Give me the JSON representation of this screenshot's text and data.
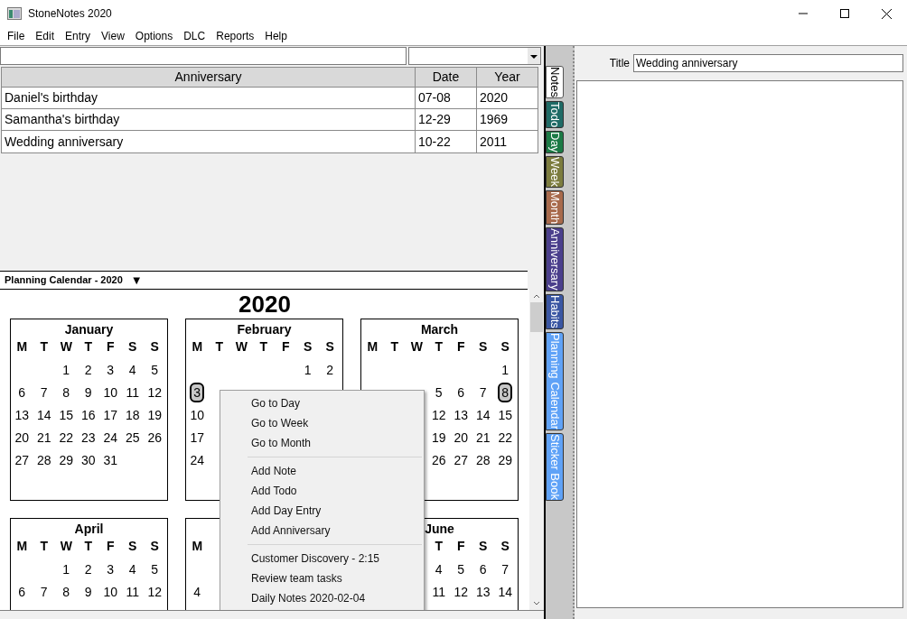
{
  "window": {
    "title": "StoneNotes 2020"
  },
  "menu_bar": [
    "File",
    "Edit",
    "Entry",
    "View",
    "Options",
    "DLC",
    "Reports",
    "Help"
  ],
  "table": {
    "columns": [
      "Anniversary",
      "Date",
      "Year"
    ],
    "rows": [
      [
        "Daniel's birthday",
        "07-08",
        "2020"
      ],
      [
        "Samantha's birthday",
        "12-29",
        "1969"
      ],
      [
        "Wedding anniversary",
        "10-22",
        "2011"
      ]
    ]
  },
  "calendar": {
    "header": "Planning Calendar - 2020",
    "dropdown_glyph": "▼",
    "year": "2020",
    "months": [
      {
        "name": "January",
        "weekdays": [
          {
            "kind": "letter",
            "text": "M"
          },
          {
            "kind": "letter",
            "text": "T"
          },
          {
            "kind": "letter",
            "text": "W"
          },
          {
            "kind": "letter",
            "text": "T"
          },
          {
            "kind": "letter",
            "text": "F"
          },
          {
            "kind": "letter",
            "text": "S"
          },
          {
            "kind": "letter",
            "text": "S"
          }
        ],
        "weeks": [
          [
            {
              "kind": "blank"
            },
            {
              "kind": "blank"
            },
            {
              "kind": "day",
              "day": "1",
              "marked": false
            },
            {
              "kind": "day",
              "day": "2",
              "marked": false
            },
            {
              "kind": "day",
              "day": "3",
              "marked": false
            },
            {
              "kind": "day",
              "day": "4",
              "marked": false
            },
            {
              "kind": "day",
              "day": "5",
              "marked": false
            }
          ],
          [
            {
              "kind": "day",
              "day": "6",
              "marked": false
            },
            {
              "kind": "day",
              "day": "7",
              "marked": false
            },
            {
              "kind": "day",
              "day": "8",
              "marked": false
            },
            {
              "kind": "day",
              "day": "9",
              "marked": false
            },
            {
              "kind": "day",
              "day": "10",
              "marked": false
            },
            {
              "kind": "day",
              "day": "11",
              "marked": false
            },
            {
              "kind": "day",
              "day": "12",
              "marked": false
            }
          ],
          [
            {
              "kind": "day",
              "day": "13",
              "marked": false
            },
            {
              "kind": "day",
              "day": "14",
              "marked": false
            },
            {
              "kind": "day",
              "day": "15",
              "marked": false
            },
            {
              "kind": "day",
              "day": "16",
              "marked": false
            },
            {
              "kind": "day",
              "day": "17",
              "marked": false
            },
            {
              "kind": "day",
              "day": "18",
              "marked": false
            },
            {
              "kind": "day",
              "day": "19",
              "marked": false
            }
          ],
          [
            {
              "kind": "day",
              "day": "20",
              "marked": false
            },
            {
              "kind": "day",
              "day": "21",
              "marked": false
            },
            {
              "kind": "day",
              "day": "22",
              "marked": false
            },
            {
              "kind": "day",
              "day": "23",
              "marked": false
            },
            {
              "kind": "day",
              "day": "24",
              "marked": false
            },
            {
              "kind": "day",
              "day": "25",
              "marked": false
            },
            {
              "kind": "day",
              "day": "26",
              "marked": false
            }
          ],
          [
            {
              "kind": "day",
              "day": "27",
              "marked": false
            },
            {
              "kind": "day",
              "day": "28",
              "marked": false
            },
            {
              "kind": "day",
              "day": "29",
              "marked": false
            },
            {
              "kind": "day",
              "day": "30",
              "marked": false
            },
            {
              "kind": "day",
              "day": "31",
              "marked": false
            },
            {
              "kind": "blank"
            },
            {
              "kind": "blank"
            }
          ]
        ]
      },
      {
        "name": "February",
        "weekdays": [
          {
            "kind": "letter",
            "text": "M"
          },
          {
            "kind": "letter",
            "text": "T"
          },
          {
            "kind": "letter",
            "text": "W"
          },
          {
            "kind": "letter",
            "text": "T"
          },
          {
            "kind": "letter",
            "text": "F"
          },
          {
            "kind": "letter",
            "text": "S"
          },
          {
            "kind": "letter",
            "text": "S"
          }
        ],
        "weeks": [
          [
            {
              "kind": "blank"
            },
            {
              "kind": "blank"
            },
            {
              "kind": "blank"
            },
            {
              "kind": "blank"
            },
            {
              "kind": "blank"
            },
            {
              "kind": "day",
              "day": "1",
              "marked": false
            },
            {
              "kind": "day",
              "day": "2",
              "marked": false
            }
          ],
          [
            {
              "kind": "day",
              "day": "3",
              "marked": true
            }
          ],
          [
            {
              "kind": "day",
              "day": "10",
              "marked": false
            }
          ],
          [
            {
              "kind": "day",
              "day": "17",
              "marked": false
            }
          ],
          [
            {
              "kind": "day",
              "day": "24",
              "marked": false
            }
          ]
        ]
      },
      {
        "name": "March",
        "weekdays": [
          {
            "kind": "letter",
            "text": "M"
          },
          {
            "kind": "letter",
            "text": "T"
          },
          {
            "kind": "letter",
            "text": "W"
          },
          {
            "kind": "letter",
            "text": "T"
          },
          {
            "kind": "letter",
            "text": "F"
          },
          {
            "kind": "letter",
            "text": "S"
          },
          {
            "kind": "letter",
            "text": "S"
          }
        ],
        "weeks": [
          [
            {
              "kind": "blank"
            },
            {
              "kind": "blank"
            },
            {
              "kind": "blank"
            },
            {
              "kind": "blank"
            },
            {
              "kind": "blank"
            },
            {
              "kind": "blank"
            },
            {
              "kind": "day",
              "day": "1",
              "marked": false
            }
          ],
          [
            {
              "kind": "blank"
            },
            {
              "kind": "blank"
            },
            {
              "kind": "blank"
            },
            {
              "kind": "day",
              "day": "5",
              "marked": false
            },
            {
              "kind": "day",
              "day": "6",
              "marked": false
            },
            {
              "kind": "day",
              "day": "7",
              "marked": false
            },
            {
              "kind": "day",
              "day": "8",
              "marked": true
            }
          ],
          [
            {
              "kind": "blank"
            },
            {
              "kind": "blank"
            },
            {
              "kind": "blank"
            },
            {
              "kind": "day",
              "day": "12",
              "marked": false
            },
            {
              "kind": "day",
              "day": "13",
              "marked": false
            },
            {
              "kind": "day",
              "day": "14",
              "marked": false
            },
            {
              "kind": "day",
              "day": "15",
              "marked": false
            }
          ],
          [
            {
              "kind": "blank"
            },
            {
              "kind": "blank"
            },
            {
              "kind": "blank"
            },
            {
              "kind": "day",
              "day": "19",
              "marked": false
            },
            {
              "kind": "day",
              "day": "20",
              "marked": false
            },
            {
              "kind": "day",
              "day": "21",
              "marked": false
            },
            {
              "kind": "day",
              "day": "22",
              "marked": false
            }
          ],
          [
            {
              "kind": "blank"
            },
            {
              "kind": "blank"
            },
            {
              "kind": "blank"
            },
            {
              "kind": "day",
              "day": "26",
              "marked": false
            },
            {
              "kind": "day",
              "day": "27",
              "marked": false
            },
            {
              "kind": "day",
              "day": "28",
              "marked": false
            },
            {
              "kind": "day",
              "day": "29",
              "marked": false
            }
          ]
        ]
      },
      {
        "name": "April",
        "weekdays": [
          {
            "kind": "letter",
            "text": "M"
          },
          {
            "kind": "letter",
            "text": "T"
          },
          {
            "kind": "letter",
            "text": "W"
          },
          {
            "kind": "letter",
            "text": "T"
          },
          {
            "kind": "letter",
            "text": "F"
          },
          {
            "kind": "letter",
            "text": "S"
          },
          {
            "kind": "letter",
            "text": "S"
          }
        ],
        "weeks": [
          [
            {
              "kind": "blank"
            },
            {
              "kind": "blank"
            },
            {
              "kind": "day",
              "day": "1",
              "marked": false
            },
            {
              "kind": "day",
              "day": "2",
              "marked": false
            },
            {
              "kind": "day",
              "day": "3",
              "marked": false
            },
            {
              "kind": "day",
              "day": "4",
              "marked": false
            },
            {
              "kind": "day",
              "day": "5",
              "marked": false
            }
          ],
          [
            {
              "kind": "day",
              "day": "6",
              "marked": false
            },
            {
              "kind": "day",
              "day": "7",
              "marked": false
            },
            {
              "kind": "day",
              "day": "8",
              "marked": false
            },
            {
              "kind": "day",
              "day": "9",
              "marked": false
            },
            {
              "kind": "day",
              "day": "10",
              "marked": false
            },
            {
              "kind": "day",
              "day": "11",
              "marked": false
            },
            {
              "kind": "day",
              "day": "12",
              "marked": false
            }
          ]
        ]
      },
      {
        "weekdays": [
          {
            "kind": "letter",
            "text": "M"
          }
        ],
        "weeks": [
          [
            {
              "kind": "blank"
            }
          ],
          [
            {
              "kind": "day",
              "day": "4",
              "marked": false
            }
          ]
        ]
      },
      {
        "name": "June",
        "weekdays": [
          {
            "kind": "blank"
          },
          {
            "kind": "blank"
          },
          {
            "kind": "blank"
          },
          {
            "kind": "letter",
            "text": "T"
          },
          {
            "kind": "letter",
            "text": "F"
          },
          {
            "kind": "letter",
            "text": "S"
          },
          {
            "kind": "letter",
            "text": "S"
          }
        ],
        "weeks": [
          [
            {
              "kind": "blank"
            },
            {
              "kind": "blank"
            },
            {
              "kind": "blank"
            },
            {
              "kind": "day",
              "day": "4",
              "marked": false
            },
            {
              "kind": "day",
              "day": "5",
              "marked": false
            },
            {
              "kind": "day",
              "day": "6",
              "marked": false
            },
            {
              "kind": "day",
              "day": "7",
              "marked": false
            }
          ],
          [
            {
              "kind": "blank"
            },
            {
              "kind": "blank"
            },
            {
              "kind": "blank"
            },
            {
              "kind": "day",
              "day": "11",
              "marked": false
            },
            {
              "kind": "day",
              "day": "12",
              "marked": false
            },
            {
              "kind": "day",
              "day": "13",
              "marked": false
            },
            {
              "kind": "day",
              "day": "14",
              "marked": false
            }
          ]
        ]
      }
    ]
  },
  "context_menu": [
    [
      "Go to Day",
      "Go to Week",
      "Go to Month"
    ],
    [
      "Add Note",
      "Add Todo",
      "Add Day Entry",
      "Add Anniversary"
    ],
    [
      "Customer Discovery - 2:15",
      "Review team tasks",
      "Daily Notes 2020-02-04"
    ]
  ],
  "side_tabs": [
    {
      "label": "Notes",
      "selected": true,
      "color": "#ffffff"
    },
    {
      "label": "Todo",
      "selected": false,
      "color": "#1f6b66"
    },
    {
      "label": "Day",
      "selected": false,
      "color": "#1b7a45"
    },
    {
      "label": "Week",
      "selected": false,
      "color": "#7c7c3e"
    },
    {
      "label": "Month",
      "selected": false,
      "color": "#a86a4c"
    },
    {
      "label": "Anniversary",
      "selected": false,
      "color": "#4b3f8c"
    },
    {
      "label": "Habits",
      "selected": false,
      "color": "#3a56a3"
    },
    {
      "label": "Planning Calendar",
      "selected": false,
      "color": "#5fa2f7"
    },
    {
      "label": "Sticker Book",
      "selected": false,
      "color": "#5fa2f7"
    }
  ],
  "editor": {
    "title_label": "Title",
    "title_value": "Wedding anniversary"
  }
}
